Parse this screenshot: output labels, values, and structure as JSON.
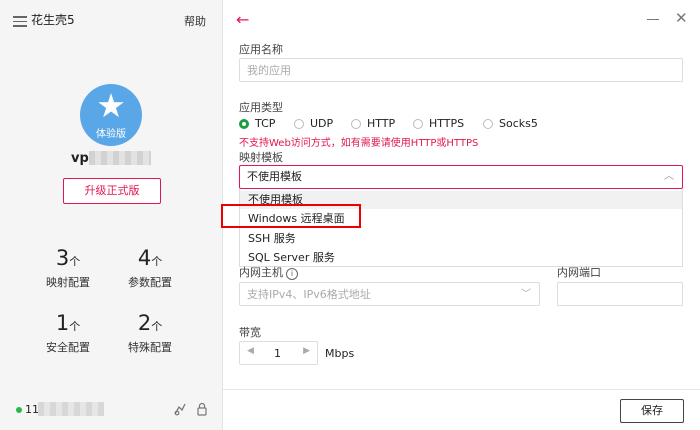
{
  "sidebar": {
    "app_name": "花生壳5",
    "help": "帮助",
    "avatar_badge": "体验版",
    "username_prefix": "vp",
    "upgrade_button": "升级正式版",
    "stats": [
      {
        "value": "3",
        "unit": "个",
        "label": "映射配置"
      },
      {
        "value": "4",
        "unit": "个",
        "label": "参数配置"
      },
      {
        "value": "1",
        "unit": "个",
        "label": "安全配置"
      },
      {
        "value": "2",
        "unit": "个",
        "label": "特殊配置"
      }
    ],
    "status_prefix": "11"
  },
  "form": {
    "app_name_label": "应用名称",
    "app_name_placeholder": "我的应用",
    "app_type_label": "应用类型",
    "app_types": [
      "TCP",
      "UDP",
      "HTTP",
      "HTTPS",
      "Socks5"
    ],
    "selected_app_type": "TCP",
    "warning": "不支持Web访问方式，如有需要请使用HTTP或HTTPS",
    "template_label": "映射模板",
    "template_selected": "不使用模板",
    "template_options": [
      "不使用模板",
      "Windows 远程桌面",
      "SSH 服务",
      "SQL Server 服务"
    ],
    "inner_host_label": "内网主机",
    "inner_host_placeholder": "支持IPv4、IPv6格式地址",
    "inner_port_label": "内网端口",
    "bandwidth_label": "带宽",
    "bandwidth_value": "1",
    "bandwidth_unit": "Mbps",
    "save_button": "保存"
  },
  "colors": {
    "accent": "#e3174f",
    "radio_checked": "#1e9e3a",
    "avatar": "#5aa7e8",
    "highlight": "#e00000"
  }
}
